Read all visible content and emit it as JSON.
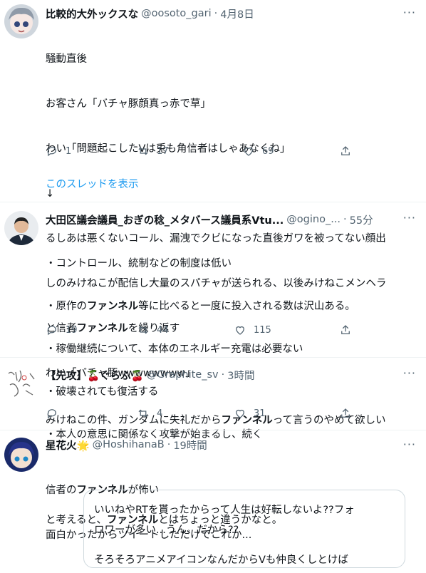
{
  "tweets": [
    {
      "name": "比較的大外ックスな",
      "handle": "@oosoto_gari",
      "time": "4月8日",
      "lines": [
        "騒動直後",
        "お客さん「バチャ豚顔真っ赤で草」",
        "わい「問題起こしたVは兎も角信者はしゃあなくね」",
        "↓",
        "るしあは悪くないコール、漏洩でクビになった直後ガワを被ってない顔出",
        "しのみけねこが配信し大量のスパチャが送られる、以後みけねこメンヘラ",
        "と信者ファンネルを繰り返す",
        "わい「バチャ豚wwwwwwww」"
      ],
      "reply": "1",
      "retweet": "17",
      "like": "69",
      "thread_link": "このスレッドを表示"
    },
    {
      "name": "大田区議会議員_おぎの稔_メタバース議員系Vtu...",
      "handle": "@ogino_...",
      "time": "55分",
      "lines": [
        "・コントロール、統制などの制度は低い",
        "・原作のファンネル等に比べると一度に投入される数は沢山ある。",
        "・稼働継続について、本体のエネルギー充電は必要ない",
        "・破壊されても復活する",
        "・本人の意思に関係なく攻撃が始まるし、続く",
        "",
        "と考えると、ファンネルとはちょっと違うかなと。"
      ],
      "reply": "19",
      "retweet": "44",
      "like": "115"
    },
    {
      "name": "【先攻】🍒ぐらふ🍒",
      "handle": "@Graphite_sv",
      "time": "3時間",
      "lines": [
        "みけねこの件、ガンダムに失礼だからファンネルって言うのやめて欲しい"
      ],
      "reply": "",
      "retweet": "4",
      "like": "31"
    },
    {
      "name": "星花火🌟",
      "handle": "@HoshihanaB",
      "time": "19時間",
      "lines": [
        "信者のファンネルが怖い",
        "面白かったからツイートしただけでこれか..."
      ],
      "quote_lines": [
        "いいねやRTを貰ったからって人生は好転しないよ??フォ",
        "ロワーが多い...うん、だから??",
        "そろそろアニメアイコンなんだからVも仲良くしとけば"
      ]
    }
  ],
  "highlight_word": "ファンネル",
  "colors": {
    "accent": "#1d9bf0",
    "muted": "#536471",
    "border": "#eff3f4"
  }
}
